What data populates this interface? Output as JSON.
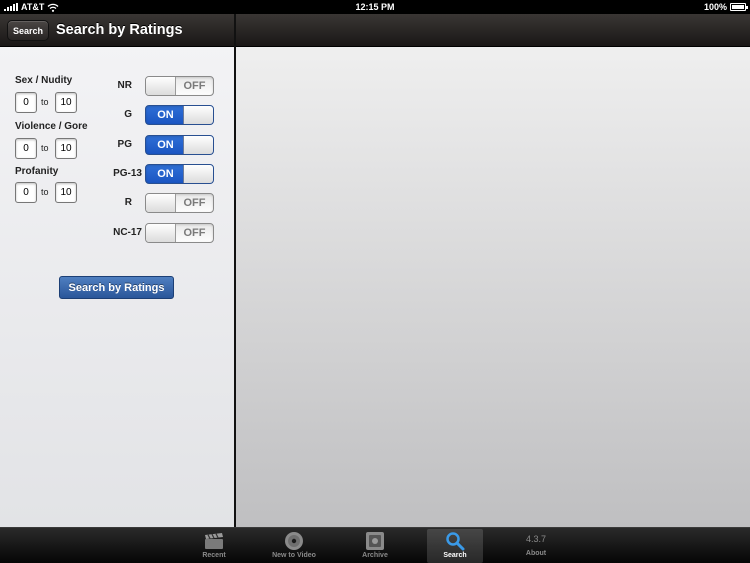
{
  "status_bar": {
    "carrier": "AT&T",
    "time": "12:15 PM",
    "battery": "100%"
  },
  "nav": {
    "back_label": "Search",
    "title": "Search by Ratings"
  },
  "ranges": [
    {
      "label": "Sex / Nudity",
      "from": "0",
      "to": "10"
    },
    {
      "label": "Violence / Gore",
      "from": "0",
      "to": "10"
    },
    {
      "label": "Profanity",
      "from": "0",
      "to": "10"
    }
  ],
  "to_text": "to",
  "ratings": [
    {
      "label": "NR",
      "state": "OFF"
    },
    {
      "label": "G",
      "state": "ON"
    },
    {
      "label": "PG",
      "state": "ON"
    },
    {
      "label": "PG-13",
      "state": "ON"
    },
    {
      "label": "R",
      "state": "OFF"
    },
    {
      "label": "NC-17",
      "state": "OFF"
    }
  ],
  "search_button": "Search by Ratings",
  "tabbar": {
    "recent": "Recent",
    "new_to_video": "New to Video",
    "archive": "Archive",
    "search": "Search",
    "version": "4.3.7",
    "about": "About"
  },
  "colors": {
    "switch_on": "#1a55c2",
    "search_button": "#2a569a",
    "navbar": "#1a1716"
  }
}
